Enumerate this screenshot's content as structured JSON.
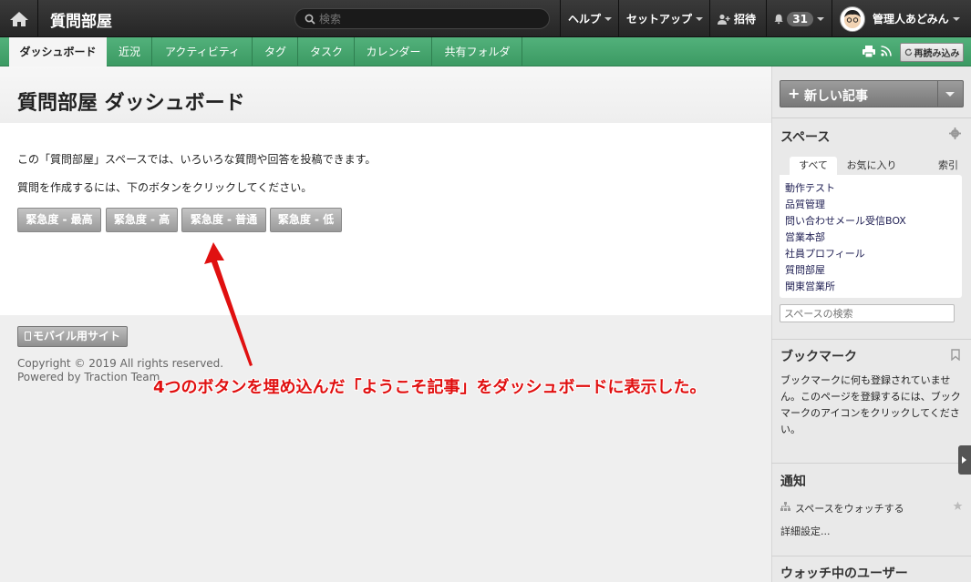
{
  "topbar": {
    "space_title": "質問部屋",
    "search_placeholder": "検索",
    "help": "ヘルプ",
    "setup": "セットアップ",
    "invite": "招待",
    "notification_count": "31",
    "user_name": "管理人あどみん"
  },
  "nav": {
    "tabs": [
      "ダッシュボード",
      "近況",
      "アクティビティ",
      "タグ",
      "タスク",
      "カレンダー",
      "共有フォルダ"
    ],
    "reload": "再読み込み"
  },
  "main": {
    "title": "質問部屋 ダッシュボード",
    "para1": "この「質問部屋」スペースでは、いろいろな質問や回答を投稿できます。",
    "para2": "質問を作成するには、下のボタンをクリックしてください。",
    "buttons": [
      "緊急度 - 最高",
      "緊急度 - 高",
      "緊急度 - 普通",
      "緊急度 - 低"
    ],
    "mobile_site": "モバイル用サイト",
    "copyright": "Copyright © 2019 All rights reserved.",
    "powered_by": "Powered by Traction Team",
    "annotation": "4つのボタンを埋め込んだ「ようこそ記事」をダッシュボードに表示した。"
  },
  "sidebar": {
    "new_post": "新しい記事",
    "spaces_title": "スペース",
    "space_tabs": [
      "すべて",
      "お気に入り",
      "索引"
    ],
    "spaces": [
      "動作テスト",
      "品質管理",
      "問い合わせメール受信BOX",
      "営業本部",
      "社員プロフィール",
      "質問部屋",
      "関東営業所"
    ],
    "space_search_placeholder": "スペースの検索",
    "bookmark_title": "ブックマーク",
    "bookmark_text": "ブックマークに何も登録されていません。このページを登録するには、ブックマークのアイコンをクリックしてください。",
    "notify_title": "通知",
    "watch_space": "スペースをウォッチする",
    "detail_settings": "詳細設定...",
    "watching_users": "ウォッチ中のユーザー"
  },
  "colors": {
    "nav_green": "#46a66f",
    "annotation_red": "#e01010"
  }
}
